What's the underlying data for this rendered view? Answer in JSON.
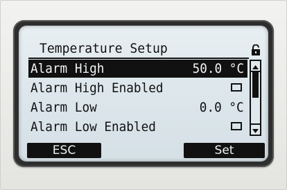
{
  "screen": {
    "title": "Temperature Setup",
    "lock_icon": "padlock-icon",
    "items": [
      {
        "label": "Alarm High",
        "value": "50.0 °C",
        "type": "value",
        "selected": true
      },
      {
        "label": "Alarm High Enabled",
        "value": "",
        "type": "checkbox",
        "checked": false
      },
      {
        "label": "Alarm Low",
        "value": "0.0 °C",
        "type": "value",
        "selected": false
      },
      {
        "label": "Alarm Low Enabled",
        "value": "",
        "type": "checkbox",
        "checked": false
      }
    ],
    "scroll": {
      "position_fraction": 0.0,
      "visible_fraction": 0.5
    },
    "softkeys": {
      "left": "ESC",
      "right": "Set"
    }
  },
  "colors": {
    "lcd_background": "#dde7ec",
    "pixel_dark": "#111111",
    "bezel": "#2e2e2e"
  }
}
